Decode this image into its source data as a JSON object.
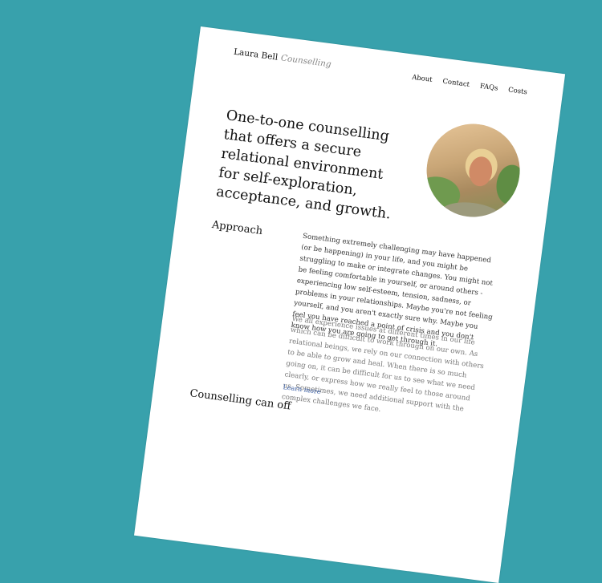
{
  "colors": {
    "background": "#38a1ac",
    "link": "#3b5fa6"
  },
  "logo": {
    "name": "Laura Bell",
    "suffix": "Counselling"
  },
  "nav": [
    "About",
    "Contact",
    "FAQs",
    "Costs"
  ],
  "hero": {
    "headline": "One-to-one counselling that offers a secure relational environment for self-exploration, acceptance, and growth.",
    "photo": "portrait-photo"
  },
  "approach": {
    "heading": "Approach",
    "paragraph1": "Something extremely challenging may have happened (or be happening) in your life, and you might be struggling to make or integrate changes. You might not be feeling comfortable in yourself, or around others - experiencing low self-esteem, tension, sadness, or problems in your relationships. Maybe you're not feeling yourself, and you aren't exactly sure why. Maybe you feel you have reached a point of crisis and you don't know how you are going to get through it.",
    "paragraph2": "We all experience issues at different times in our life which can be difficult to work through on our own. As relational beings, we rely on our connection with others to be able to grow and heal. When there is so much going on, it can be difficult for us to see what we need clearly, or express how we really feel to those around us. Sometimes, we need additional support with the complex challenges we face.",
    "link": "Learn more"
  },
  "next_heading": "Counselling can off"
}
